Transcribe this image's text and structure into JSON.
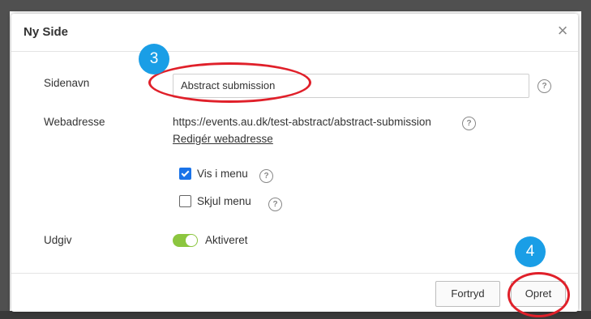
{
  "dialog": {
    "title": "Ny Side",
    "close_glyph": "×"
  },
  "form": {
    "page_name_label": "Sidenavn",
    "page_name_value": "Abstract submission",
    "web_address_label": "Webadresse",
    "web_address_value": "https://events.au.dk/test-abstract/abstract-submission",
    "edit_address_link": "Redigér webadresse",
    "show_in_menu_label": "Vis i menu",
    "show_in_menu_checked": true,
    "hide_menu_label": "Skjul menu",
    "hide_menu_checked": false,
    "publish_label": "Udgiv",
    "publish_state_label": "Aktiveret",
    "publish_enabled": true,
    "help_glyph": "?"
  },
  "footer": {
    "cancel_label": "Fortryd",
    "create_label": "Opret"
  },
  "annotations": {
    "step_a": "3",
    "step_b": "4",
    "badge_color": "#1a9ee6",
    "ring_color": "#e0202a"
  },
  "colors": {
    "toggle_on": "#8cc63f",
    "checkbox_checked": "#1a73e8"
  }
}
